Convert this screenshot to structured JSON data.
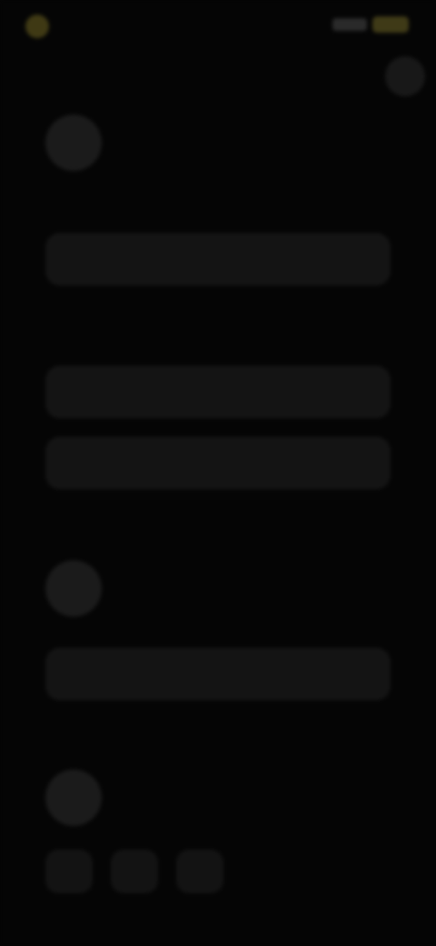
{
  "status_bar": {
    "time": "",
    "brand_color": "#4a4318",
    "battery_color": "#3f3a17"
  },
  "section_1": {
    "title": "",
    "subtitle": "",
    "primary_button": "",
    "note": "",
    "secondary_button": "",
    "tertiary_button": ""
  },
  "section_2": {
    "title": "",
    "subtitle": "",
    "button": ""
  },
  "section_3": {
    "title": "",
    "subtitle": "",
    "chips": [
      "",
      "",
      ""
    ]
  },
  "colors": {
    "background": "#050505",
    "surface": "#141414"
  }
}
